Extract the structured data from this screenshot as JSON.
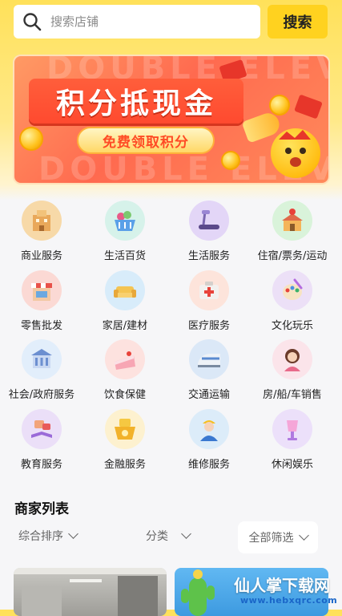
{
  "search": {
    "placeholder": "搜索店铺",
    "button_label": "搜索"
  },
  "banner": {
    "bg_text": "DOUBLE ELEVEN",
    "title": "积分抵现金",
    "cta": "免费领取积分"
  },
  "categories": [
    {
      "label": "商业服务",
      "icon": "office-building-icon",
      "color": "#f7d9a8"
    },
    {
      "label": "生活百货",
      "icon": "shopping-basket-icon",
      "color": "#d6f2ea"
    },
    {
      "label": "生活服务",
      "icon": "treadmill-icon",
      "color": "#e3d6f7"
    },
    {
      "label": "住宿/票务/运动",
      "icon": "house-pin-icon",
      "color": "#d9f3da"
    },
    {
      "label": "零售批发",
      "icon": "storefront-icon",
      "color": "#fbd9d4"
    },
    {
      "label": "家居/建材",
      "icon": "sofa-icon",
      "color": "#d8ecfa"
    },
    {
      "label": "医疗服务",
      "icon": "medical-kit-icon",
      "color": "#fde4db"
    },
    {
      "label": "文化玩乐",
      "icon": "palette-icon",
      "color": "#ece0f7"
    },
    {
      "label": "社会/政府服务",
      "icon": "government-building-icon",
      "color": "#e2eefb"
    },
    {
      "label": "饮食保健",
      "icon": "cake-icon",
      "color": "#fde2df"
    },
    {
      "label": "交通运输",
      "icon": "train-icon",
      "color": "#dbe8f7"
    },
    {
      "label": "房/船/车销售",
      "icon": "saleswoman-icon",
      "color": "#fbe4ea"
    },
    {
      "label": "教育服务",
      "icon": "book-icon",
      "color": "#ebdff8"
    },
    {
      "label": "金融服务",
      "icon": "money-basket-icon",
      "color": "#fdf1cf"
    },
    {
      "label": "维修服务",
      "icon": "repairman-icon",
      "color": "#dcecf9"
    },
    {
      "label": "休闲娱乐",
      "icon": "cocktail-icon",
      "color": "#ece0fa"
    }
  ],
  "merchants": {
    "title": "商家列表",
    "sort_label": "综合排序",
    "category_label": "分类",
    "filter_label": "全部筛选"
  },
  "watermark": {
    "main": "仙人掌下载网",
    "sub": "www.hebxqrc.com"
  },
  "colors": {
    "accent": "#ffd21f",
    "banner_red": "#ff5e3b"
  }
}
